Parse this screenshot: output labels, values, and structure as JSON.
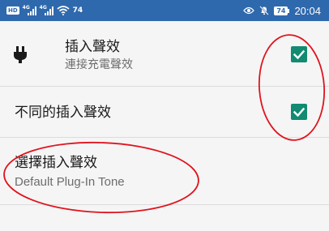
{
  "status_bar": {
    "left_badge": "HD",
    "signal_1_label": "4G",
    "signal_2_label": "4G",
    "net_speed": "74",
    "battery": "74",
    "time": "20:04",
    "icons": [
      "hd-icon",
      "signal-icon",
      "wifi-icon",
      "eye-icon",
      "mute-icon",
      "battery-icon"
    ]
  },
  "settings": {
    "items": [
      {
        "title": "插入聲效",
        "subtitle": "連接充電聲效",
        "icon": "plug-icon",
        "checked": true
      },
      {
        "title": "不同的插入聲效",
        "checked": true
      },
      {
        "title": "選擇插入聲效",
        "subtitle": "Default Plug-In Tone"
      }
    ]
  },
  "colors": {
    "status_bar": "#2f69ad",
    "checkbox": "#138a72",
    "annotation": "#e0141e",
    "background": "#f5f5f5"
  }
}
